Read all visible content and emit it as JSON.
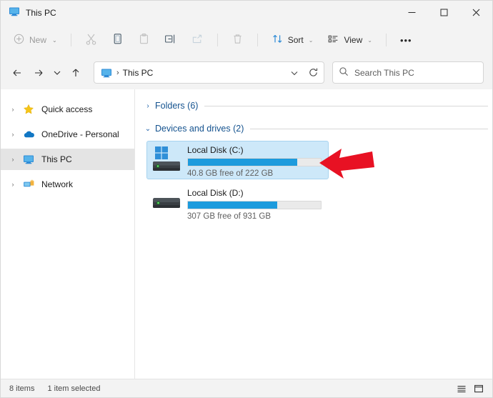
{
  "window": {
    "title": "This PC",
    "title_icon": "this-pc-monitor-icon",
    "minimize": "─",
    "maximize": "□",
    "close": "✕"
  },
  "toolbar": {
    "new_label": "New",
    "new_icon": "circle-plus-icon",
    "chevron": "⌄",
    "cut_icon": "scissors-icon",
    "copy_icon": "copy-icon",
    "paste_icon": "paste-icon",
    "rename_icon": "rename-icon",
    "share_icon": "share-icon",
    "delete_icon": "trash-icon",
    "sort_label": "Sort",
    "sort_icon": "sort-arrows-icon",
    "view_label": "View",
    "view_icon": "view-list-icon",
    "more_label": "•••"
  },
  "nav": {
    "back_icon": "←",
    "forward_icon": "→",
    "recent_icon": "⌄",
    "up_icon": "↑",
    "refresh_icon": "refresh-icon",
    "address_chevron": "⌄",
    "breadcrumb_icon": "this-pc-monitor-icon",
    "breadcrumb_sep": "›",
    "breadcrumb_text": "This PC"
  },
  "search": {
    "icon": "search-icon",
    "placeholder": "Search This PC",
    "value": ""
  },
  "sidebar": {
    "items": [
      {
        "label": "Quick access",
        "icon": "star-icon",
        "chevron": "›",
        "selected": false
      },
      {
        "label": "OneDrive - Personal",
        "icon": "cloud-icon",
        "chevron": "›",
        "selected": false
      },
      {
        "label": "This PC",
        "icon": "this-pc-monitor-icon",
        "chevron": "›",
        "selected": true
      },
      {
        "label": "Network",
        "icon": "network-icon",
        "chevron": "›",
        "selected": false
      }
    ]
  },
  "content": {
    "groups": [
      {
        "title": "Folders (6)",
        "chevron": "›",
        "expanded": false
      },
      {
        "title": "Devices and drives (2)",
        "chevron": "⌄",
        "expanded": true
      }
    ],
    "drives": [
      {
        "name": "Local Disk (C:)",
        "usage_text": "40.8 GB free of 222 GB",
        "free_gb": 40.8,
        "total_gb": 222,
        "used_percent": 82,
        "selected": true,
        "icon": "windows-system-drive-icon",
        "bar_color": "#1d9bdd"
      },
      {
        "name": "Local Disk (D:)",
        "usage_text": "307 GB free of 931 GB",
        "free_gb": 307,
        "total_gb": 931,
        "used_percent": 67,
        "selected": false,
        "icon": "hard-drive-icon",
        "bar_color": "#1d9bdd"
      }
    ]
  },
  "annotation": {
    "arrow_color": "#e81123",
    "arrow_direction": "left",
    "points_at": "Local Disk (C:)"
  },
  "statusbar": {
    "item_count": "8 items",
    "selection": "1 item selected",
    "details_view_icon": "details-view-icon",
    "large_icons_view_icon": "large-icons-view-icon"
  }
}
